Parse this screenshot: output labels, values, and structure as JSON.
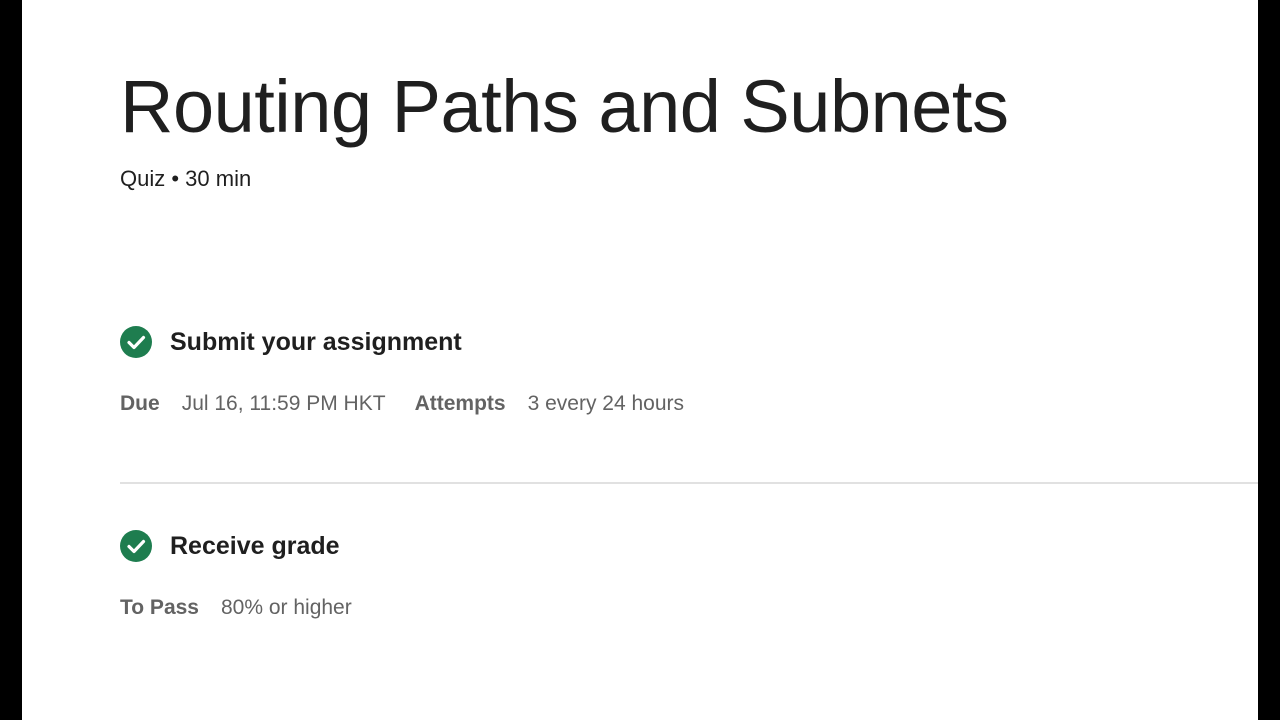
{
  "header": {
    "title": "Routing Paths and Subnets",
    "subtitle": "Quiz • 30 min"
  },
  "steps": [
    {
      "title": "Submit your assignment",
      "status": "complete",
      "icon": "check-circle-icon",
      "meta": [
        {
          "label": "Due",
          "value": "Jul 16, 11:59 PM HKT"
        },
        {
          "label": "Attempts",
          "value": "3 every 24 hours"
        }
      ]
    },
    {
      "title": "Receive grade",
      "status": "complete",
      "icon": "check-circle-icon",
      "meta": [
        {
          "label": "To Pass",
          "value": "80% or higher"
        }
      ]
    }
  ],
  "colors": {
    "check_green": "#1e7d4f",
    "text_primary": "#1f1f1f",
    "text_secondary": "#636363",
    "divider": "#e1e1e1"
  }
}
